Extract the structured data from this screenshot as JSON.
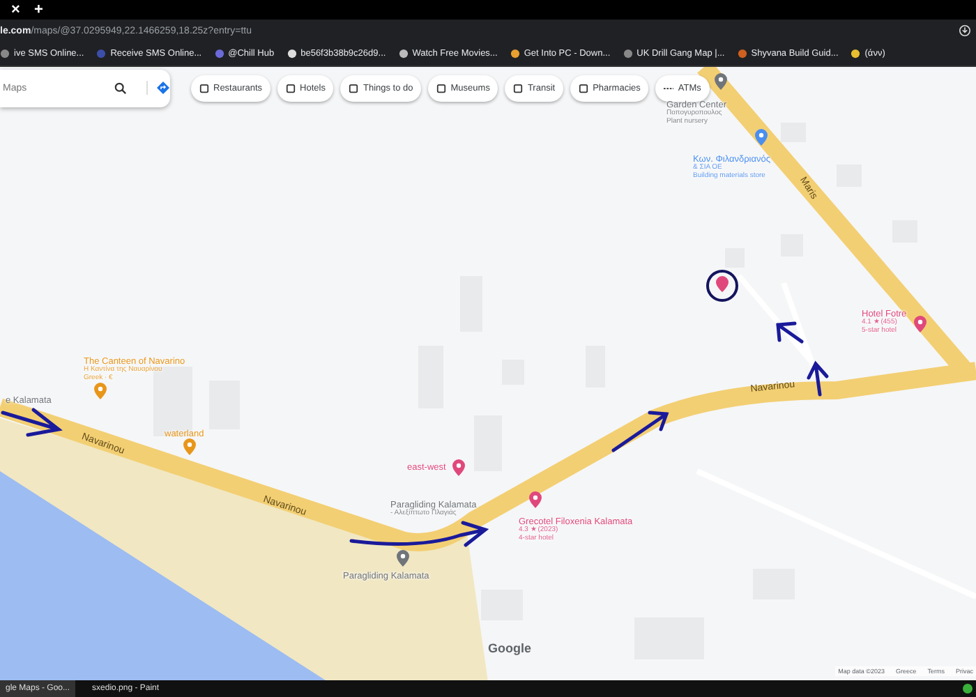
{
  "browser": {
    "close_tab": "×",
    "new_tab": "+",
    "url_host": "le.com",
    "url_path": "/maps/@37.0295949,22.1466259,18.25z?entry=ttu"
  },
  "bookmarks": [
    "ive SMS Online...",
    "Receive SMS Online...",
    "@Chill Hub",
    "be56f3b38b9c26d9...",
    "Watch Free Movies...",
    "Get Into PC - Down...",
    "UK Drill Gang Map |...",
    "Shyvana Build Guid...",
    "(άνν)"
  ],
  "search": {
    "placeholder": "Maps"
  },
  "chips": [
    "Restaurants",
    "Hotels",
    "Things to do",
    "Museums",
    "Transit",
    "Pharmacies",
    "ATMs"
  ],
  "roads": [
    "Maris",
    "Navarinou",
    "Navarinou",
    "Navarinou"
  ],
  "places": [
    {
      "name": "Garden Center",
      "lines": [
        "Ποπογυροπουλος",
        "Plant nursery"
      ],
      "kind": "park"
    },
    {
      "name": "Κων. Φιλανδριανός",
      "lines": [
        "& ΣΙΑ ΟΕ",
        "Building materials store"
      ],
      "kind": "shop"
    },
    {
      "name": "Hotel Fotre",
      "lines": [
        "4.1 ★ (455)",
        "5-star hotel"
      ],
      "kind": "hotel"
    },
    {
      "name": "The Canteen of Navarino",
      "lines": [
        "Η Καντίνα της Ναυαρίνου",
        "Greek · €"
      ],
      "kind": "food"
    },
    {
      "name": "e Kalamata",
      "kind": "park"
    },
    {
      "name": "waterland",
      "kind": "food"
    },
    {
      "name": "east-west",
      "kind": "hotel"
    },
    {
      "name": "Paragliding Kalamata",
      "lines": [
        "- Αλεξίπτωτο Πλαγιάς"
      ],
      "kind": "label"
    },
    {
      "name": "Grecotel Filoxenia Kalamata",
      "lines": [
        "4.3 ★ (2023)",
        "4-star hotel"
      ],
      "kind": "hotel"
    },
    {
      "name": "Paragliding Kalamata",
      "kind": "park"
    }
  ],
  "google_logo": "Google",
  "footer": [
    "Map data ©2023",
    "Greece",
    "Terms",
    "Privac"
  ],
  "taskbar": [
    "gle Maps - Goo...",
    "sxedio.png - Paint"
  ]
}
